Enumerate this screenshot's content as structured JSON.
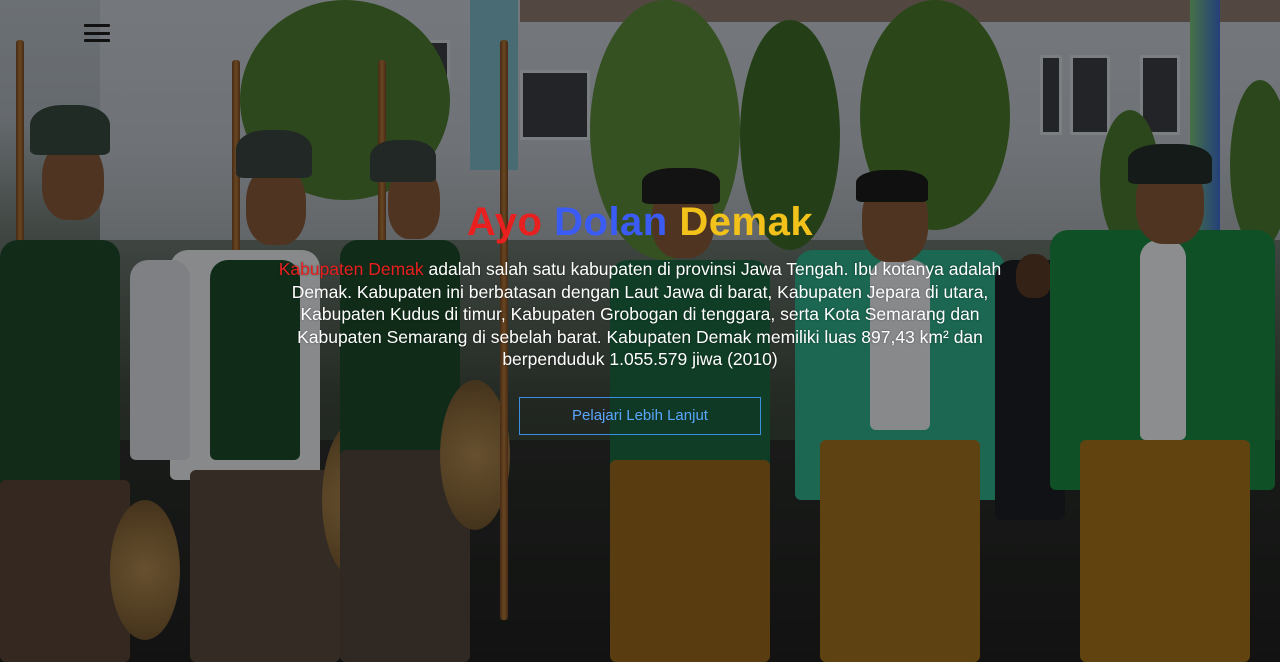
{
  "header": {
    "menu_icon": "hamburger-menu-icon"
  },
  "hero": {
    "title_parts": [
      "Ayo",
      "Dolan",
      "Demak"
    ],
    "title_colors": [
      "#e8201f",
      "#3b5bf5",
      "#f3c21a"
    ],
    "description_highlight": "Kabupaten Demak",
    "description_rest": " adalah salah satu kabupaten di provinsi Jawa Tengah. Ibu kotanya adalah Demak. Kabupaten ini berbatasan dengan Laut Jawa di barat, Kabupaten Jepara di utara, Kabupaten Kudus di timur, Kabupaten Grobogan di tenggara, serta Kota Semarang dan Kabupaten Semarang di sebelah barat. Kabupaten Demak memiliki luas 897,43 km² dan berpenduduk 1.055.579 jiwa (2010)",
    "cta_label": "Pelajari Lebih Lanjut",
    "highlight_color": "#e8201f",
    "cta_color": "#3b8fe0"
  }
}
